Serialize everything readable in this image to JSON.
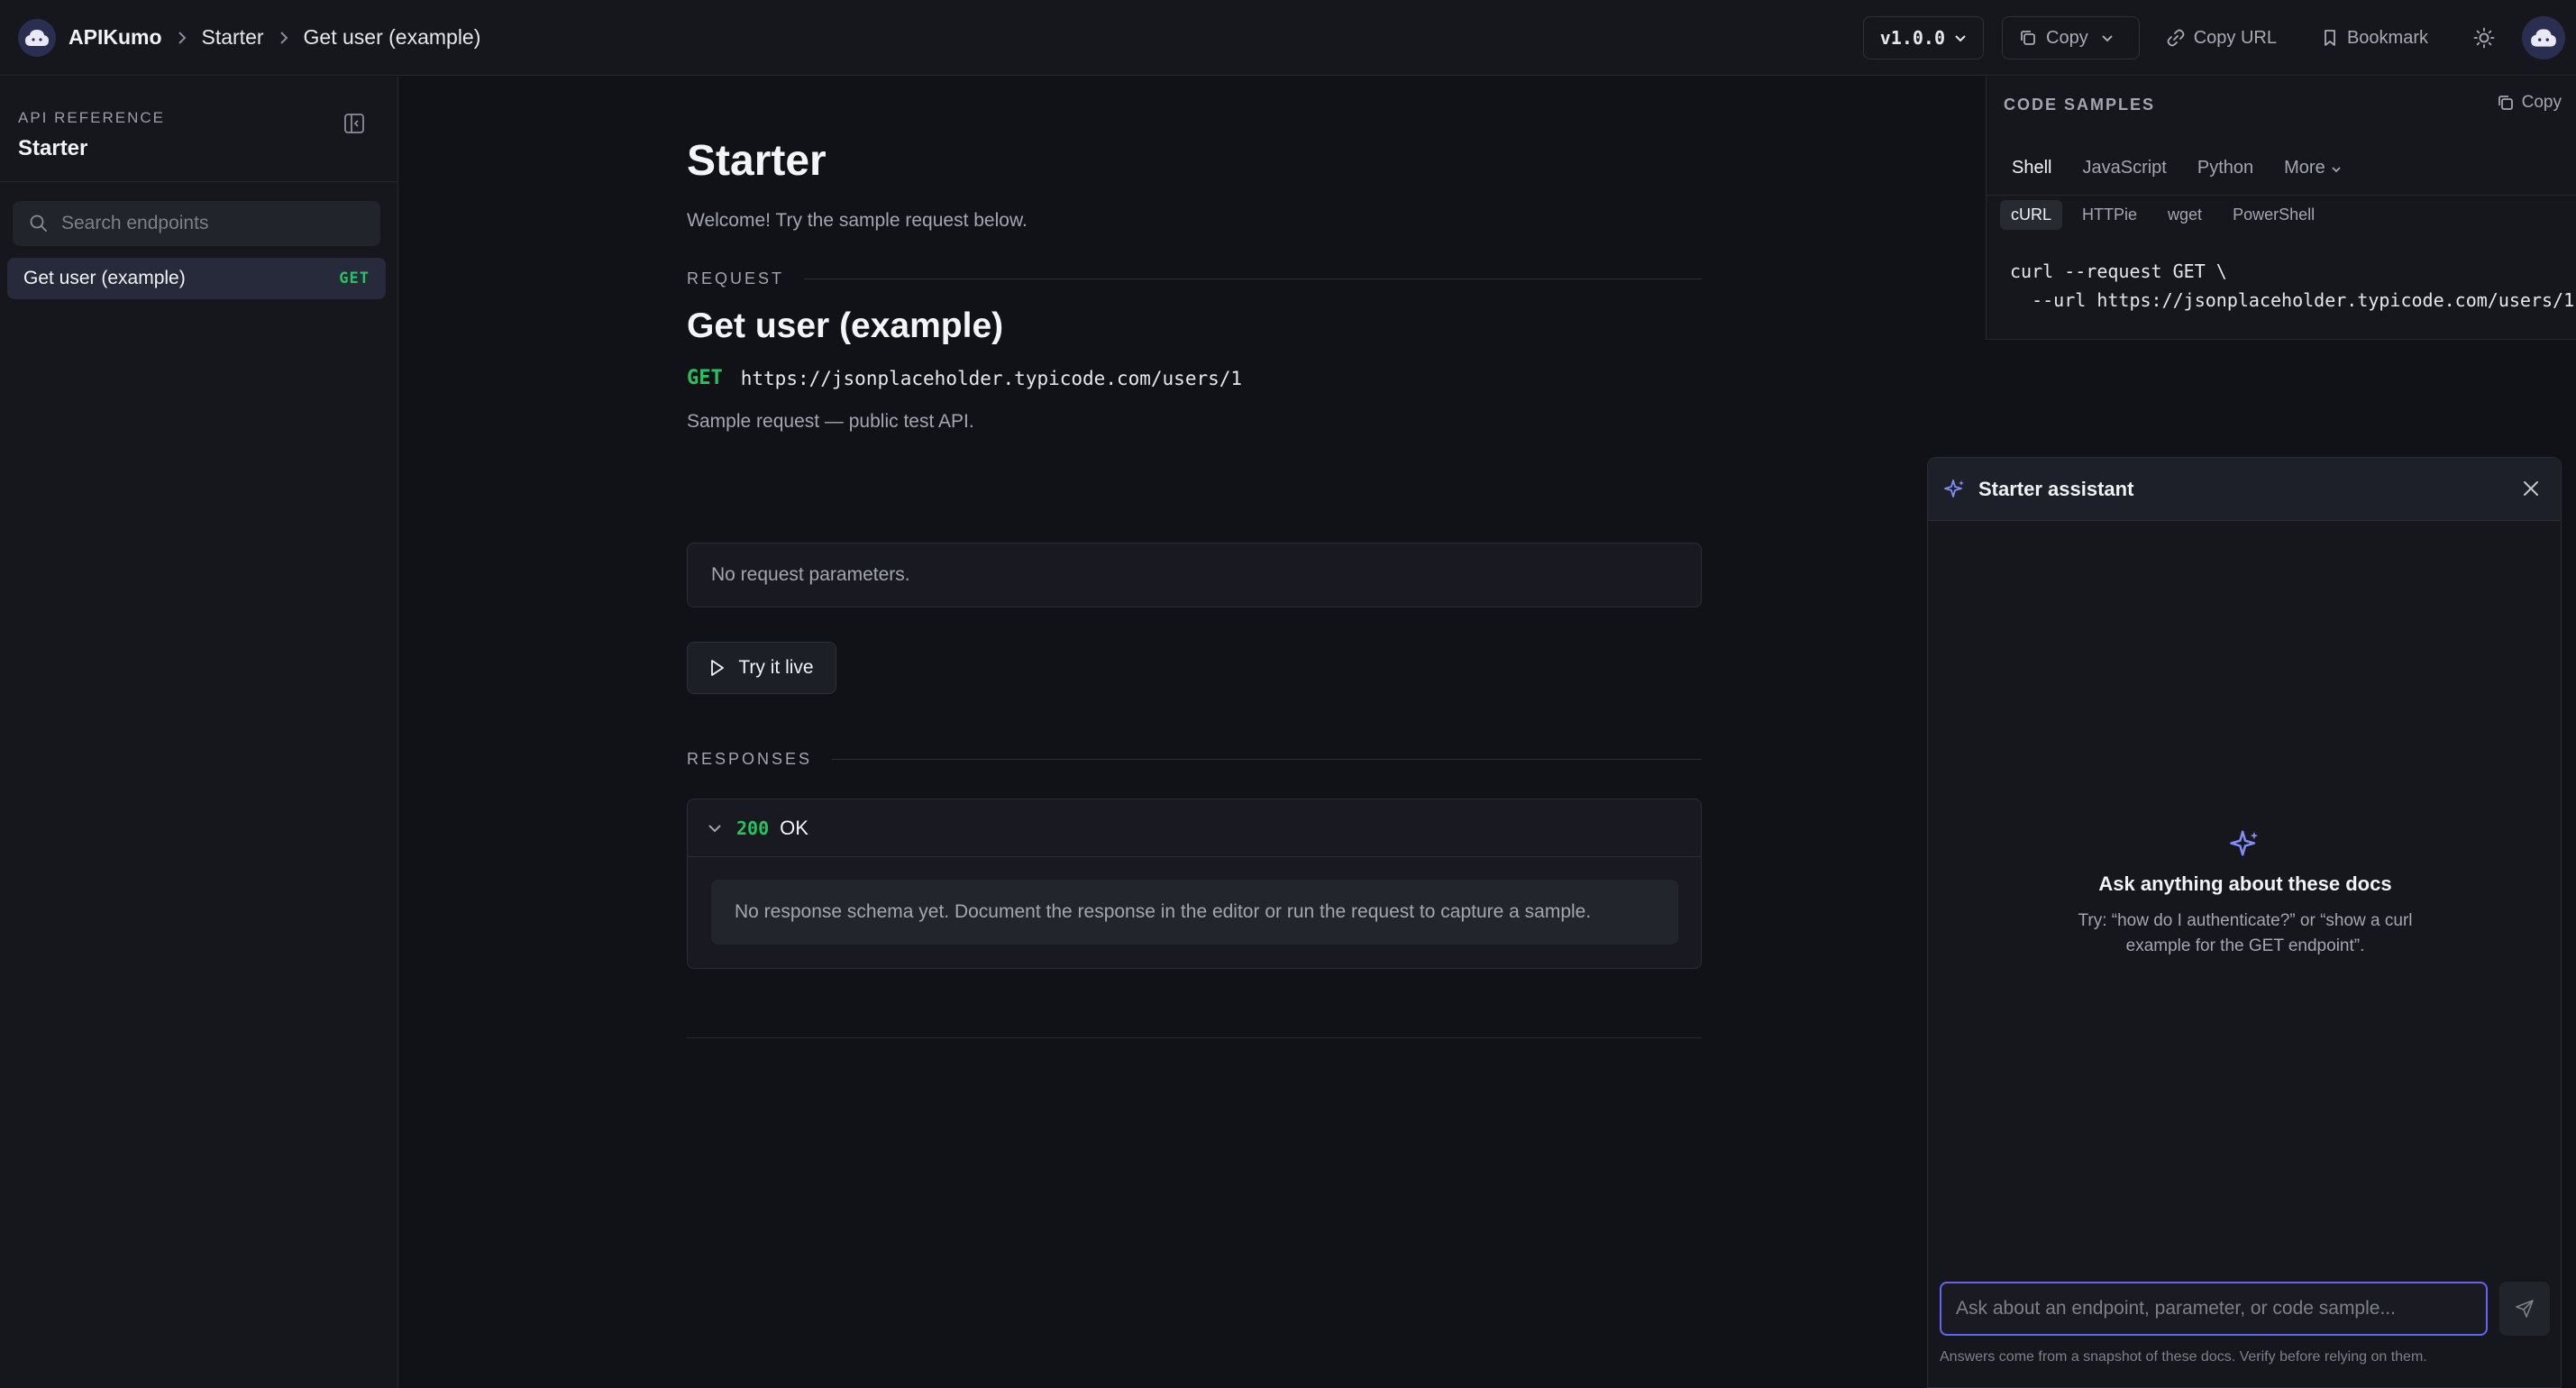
{
  "header": {
    "brand": "APIKumo",
    "breadcrumbs": [
      "Starter",
      "Get user (example)"
    ],
    "version": "v1.0.0",
    "copy_label": "Copy",
    "copy_url_label": "Copy URL",
    "bookmark_label": "Bookmark"
  },
  "sidebar": {
    "section_label": "API REFERENCE",
    "title": "Starter",
    "search_placeholder": "Search endpoints",
    "items": [
      {
        "label": "Get user (example)",
        "method": "GET",
        "active": true
      }
    ]
  },
  "main": {
    "title": "Starter",
    "description": "Welcome! Try the sample request below.",
    "endpoint": {
      "title": "Get user (example)",
      "method": "GET",
      "url": "https://jsonplaceholder.typicode.com/users/1",
      "description": "Sample request — public test API."
    },
    "request": {
      "label": "REQUEST",
      "empty_text": "No request parameters."
    },
    "try_label": "Try it live",
    "responses": {
      "label": "RESPONSES",
      "items": [
        {
          "code": "200",
          "text": "OK",
          "empty_text": "No response schema yet. Document the response in the editor or run the request to capture a sample."
        }
      ]
    }
  },
  "code_samples": {
    "label": "CODE SAMPLES",
    "copy_label": "Copy",
    "languages": [
      "Shell",
      "JavaScript",
      "Python",
      "More"
    ],
    "active_language": "Shell",
    "clients": [
      "cURL",
      "HTTPie",
      "wget",
      "PowerShell"
    ],
    "active_client": "cURL",
    "code_lines": [
      "curl --request GET \\",
      "  --url https://jsonplaceholder.typicode.com/users/1"
    ]
  },
  "assistant": {
    "title": "Starter assistant",
    "empty_title": "Ask anything about these docs",
    "empty_hint": "Try: “how do I authenticate?” or “show a curl example for the GET endpoint”.",
    "input_placeholder": "Ask about an endpoint, parameter, or code sample...",
    "footer": "Answers come from a snapshot of these docs. Verify before relying on them."
  },
  "colors": {
    "accent": "#6366f1",
    "method_get": "#22c55e",
    "background": "#111217",
    "panel": "#16171d"
  }
}
